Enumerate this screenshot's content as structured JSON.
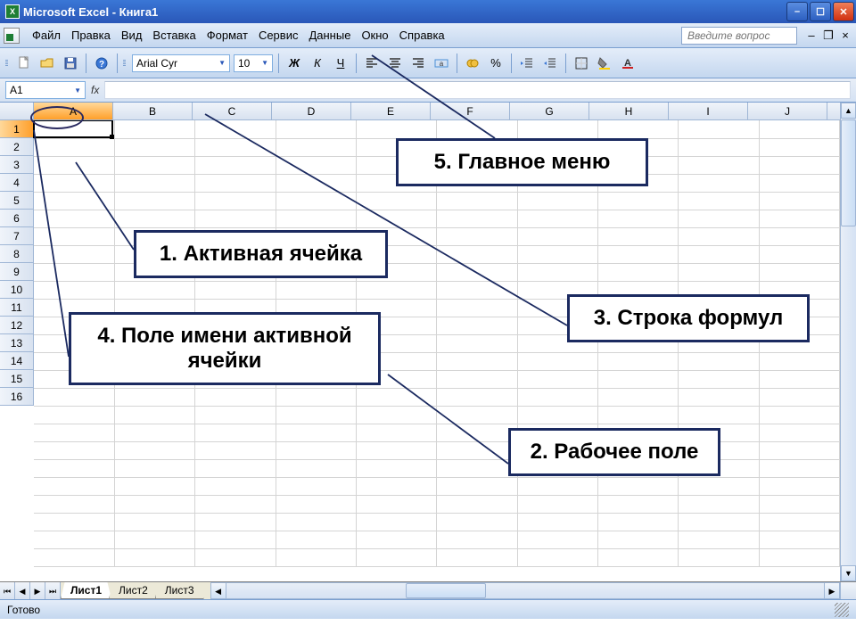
{
  "titlebar": {
    "title": "Microsoft Excel - Книга1"
  },
  "menu": {
    "items": [
      "Файл",
      "Правка",
      "Вид",
      "Вставка",
      "Формат",
      "Сервис",
      "Данные",
      "Окно",
      "Справка"
    ],
    "ask_placeholder": "Введите вопрос"
  },
  "toolbar": {
    "font_name": "Arial Cyr",
    "font_size": "10"
  },
  "formula_bar": {
    "name_box": "A1",
    "fx_label": "fx"
  },
  "grid": {
    "columns": [
      "A",
      "B",
      "C",
      "D",
      "E",
      "F",
      "G",
      "H",
      "I",
      "J"
    ],
    "rows": [
      "1",
      "2",
      "3",
      "4",
      "5",
      "6",
      "7",
      "8",
      "9",
      "10",
      "11",
      "12",
      "13",
      "14",
      "15",
      "16"
    ],
    "active_col": "A",
    "active_row": "1"
  },
  "sheets": {
    "tabs": [
      "Лист1",
      "Лист2",
      "Лист3"
    ],
    "active_index": 0
  },
  "status": {
    "text": "Готово"
  },
  "callouts": {
    "c1": "1.  Активная ячейка",
    "c2": "2. Рабочее поле",
    "c3": "3. Строка формул",
    "c4": "4. Поле имени активной ячейки",
    "c5": "5. Главное меню"
  }
}
